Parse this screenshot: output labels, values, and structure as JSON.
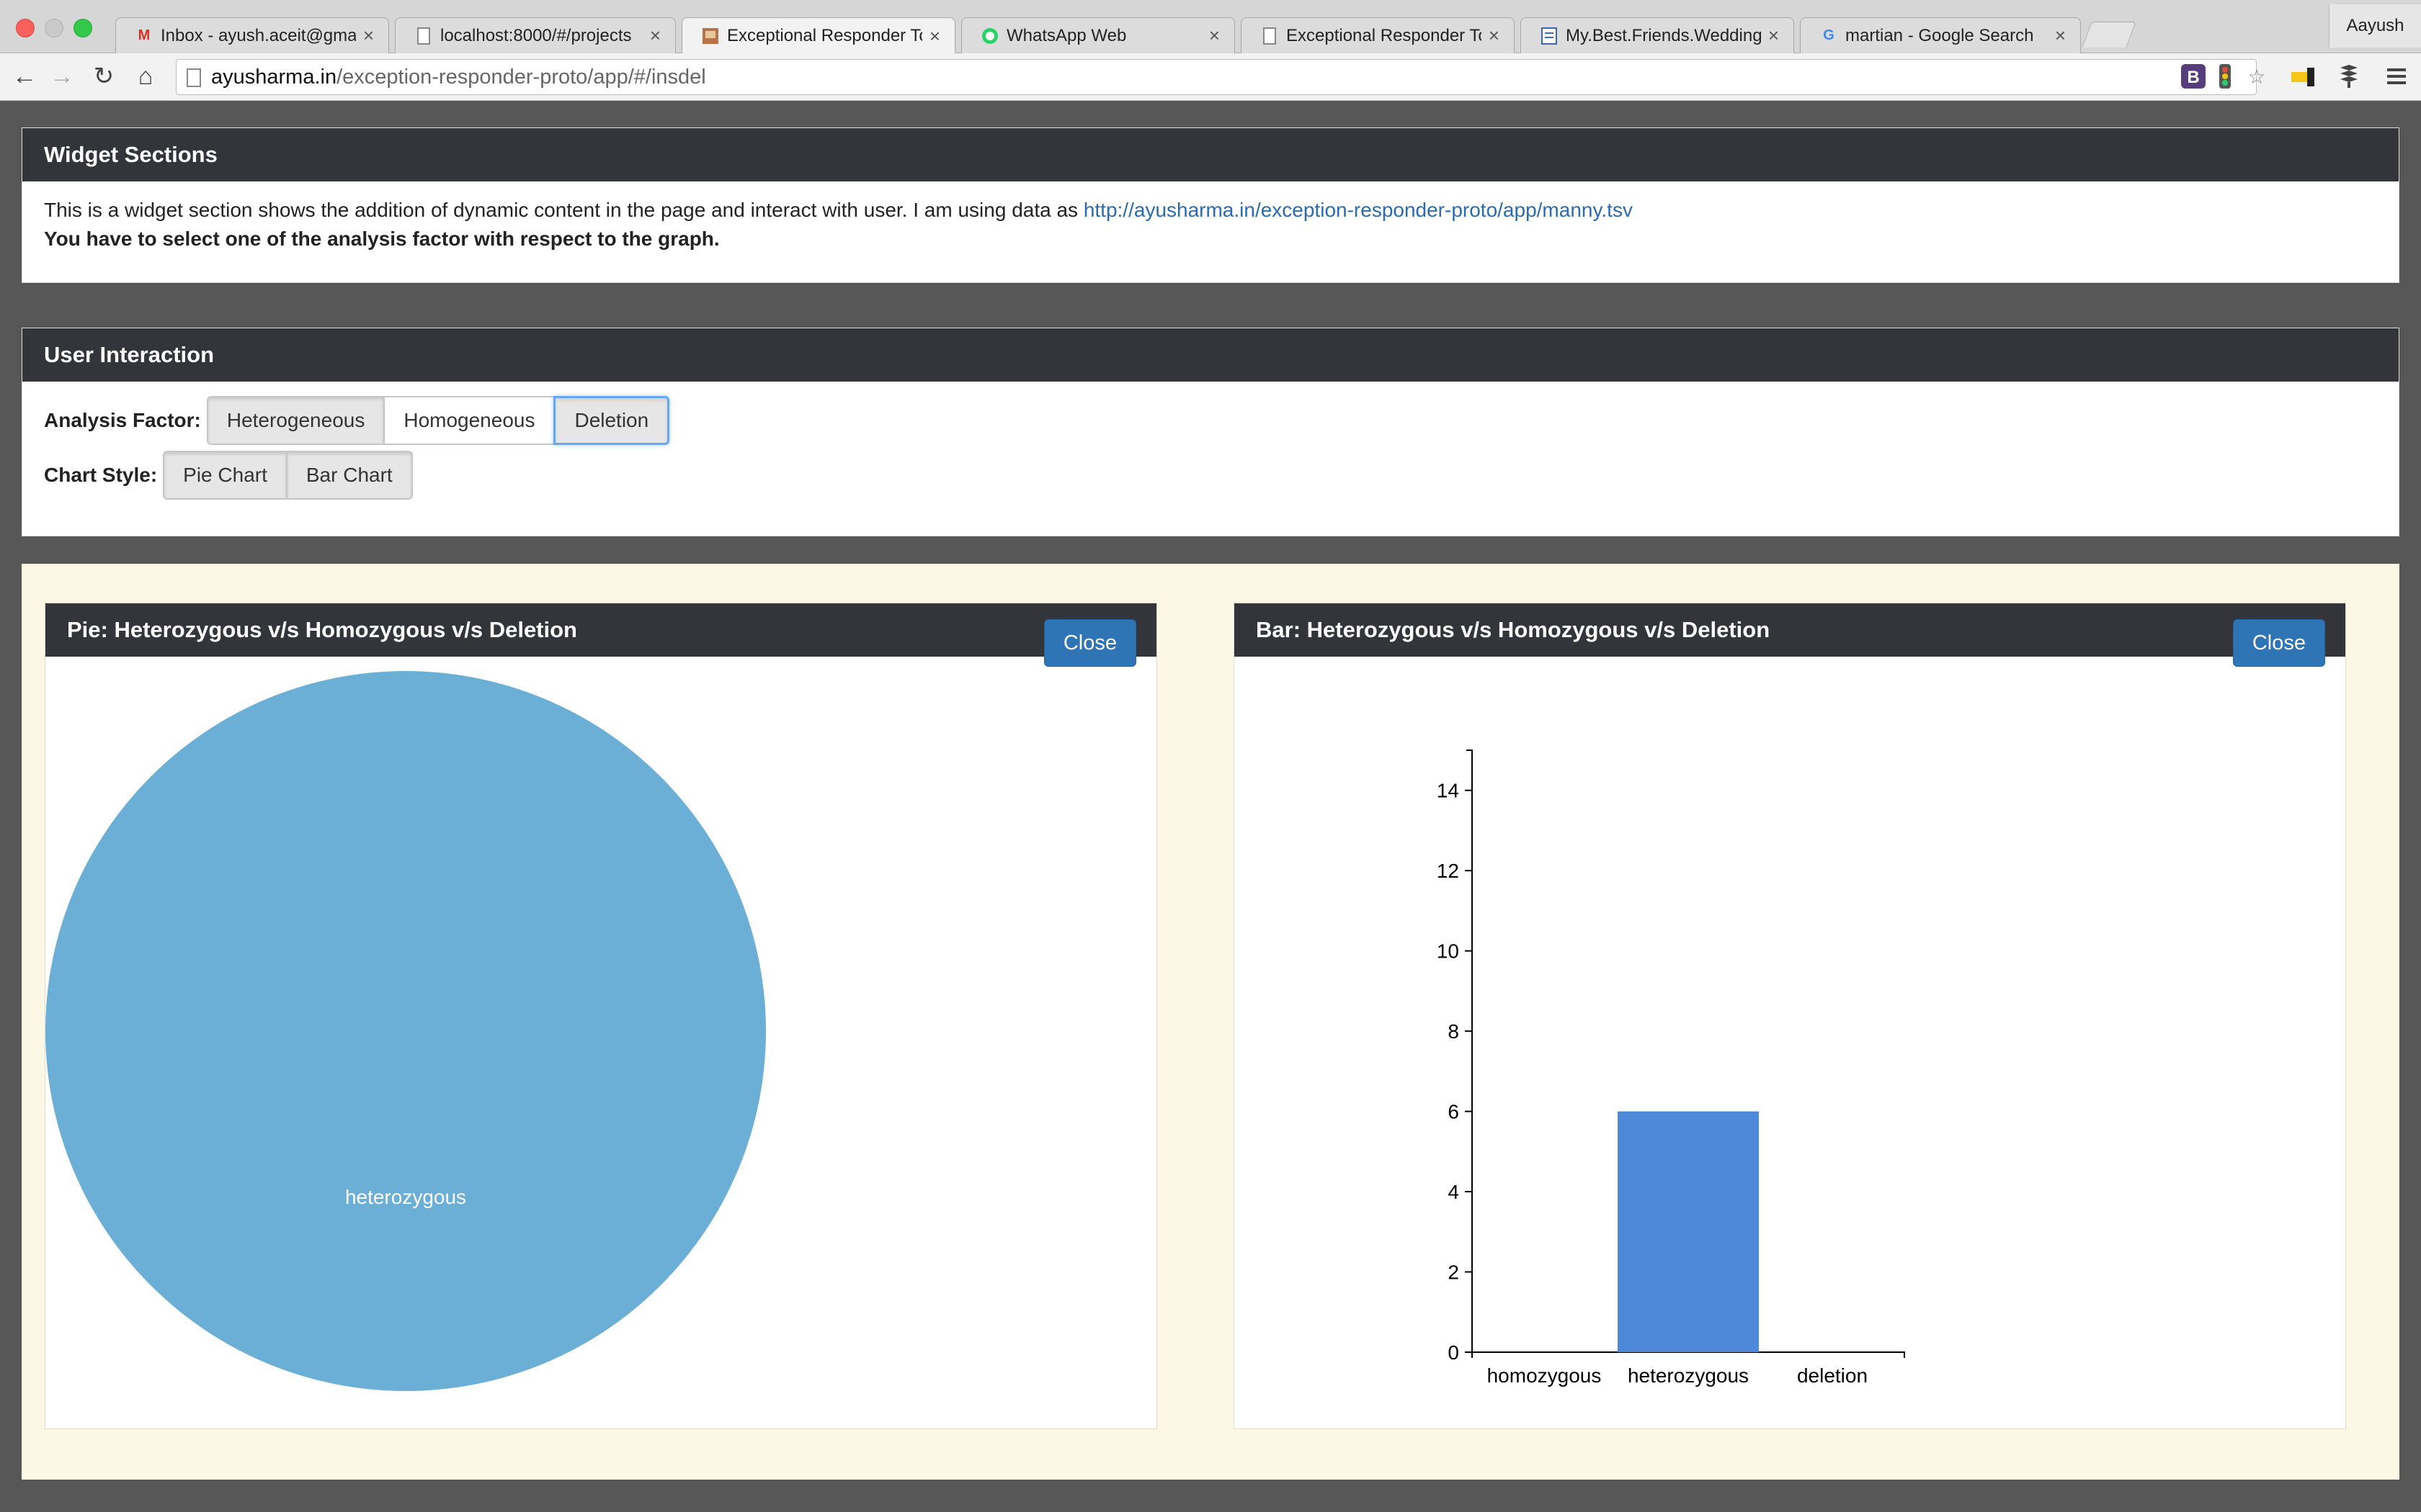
{
  "browser": {
    "tabs": [
      {
        "title": "Inbox - ayush.aceit@gmail.",
        "icon": "gmail-icon",
        "active": false
      },
      {
        "title": "localhost:8000/#/projects",
        "icon": "page-icon",
        "active": false
      },
      {
        "title": "Exceptional Responder Too",
        "icon": "site-icon",
        "active": true
      },
      {
        "title": "WhatsApp Web",
        "icon": "whatsapp-icon",
        "active": false
      },
      {
        "title": "Exceptional Responder Too",
        "icon": "page-icon",
        "active": false
      },
      {
        "title": "My.Best.Friends.Wedding.(",
        "icon": "doc-icon",
        "active": false
      },
      {
        "title": "martian - Google Search",
        "icon": "google-icon",
        "active": false
      }
    ],
    "profile_name": "Aayush",
    "url_host": "ayusharma.in",
    "url_path": "/exception-responder-proto/app/#/insdel",
    "extensions": [
      "bootstrap-icon",
      "traffic-light-icon",
      "star-icon",
      "key-icon",
      "layers-icon",
      "menu-icon"
    ]
  },
  "widget_sections": {
    "title": "Widget Sections",
    "description": "This is a widget section shows the addition of dynamic content in the page and interact with user. I am using data as",
    "data_link": "http://ayusharma.in/exception-responder-proto/app/manny.tsv",
    "instruction": "You have to select one of the analysis factor with respect to the graph."
  },
  "user_interaction": {
    "title": "User Interaction",
    "analysis_label": "Analysis Factor:",
    "analysis_options": [
      "Heterogeneous",
      "Homogeneous",
      "Deletion"
    ],
    "chart_style_label": "Chart Style:",
    "chart_style_options": [
      "Pie Chart",
      "Bar Chart"
    ]
  },
  "pie_panel": {
    "title": "Pie: Heterozygous v/s Homozygous v/s Deletion",
    "close_label": "Close"
  },
  "bar_panel": {
    "title": "Bar: Heterozygous v/s Homozygous v/s Deletion",
    "close_label": "Close"
  },
  "colors": {
    "pie_slice": "#6baed6",
    "bar_fill": "#4e89d9",
    "panel_header": "#34353a",
    "primary_button": "#2f74b5"
  },
  "chart_data": [
    {
      "type": "pie",
      "slices": [
        {
          "label": "heterozygous",
          "value": 6
        }
      ]
    },
    {
      "type": "bar",
      "categories": [
        "homozygous",
        "heterozygous",
        "deletion"
      ],
      "values": [
        0,
        6,
        0
      ],
      "yticks": [
        0,
        2,
        4,
        6,
        8,
        10,
        12,
        14
      ],
      "ylim": [
        0,
        15
      ]
    }
  ]
}
